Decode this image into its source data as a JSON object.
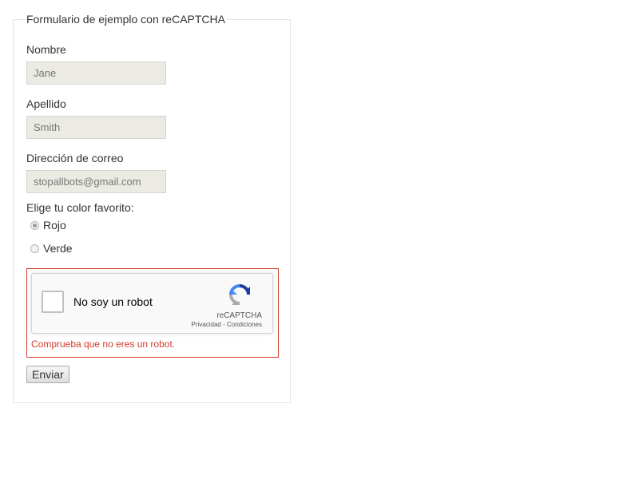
{
  "form": {
    "legend": "Formulario de ejemplo con reCAPTCHA",
    "fields": [
      {
        "label": "Nombre",
        "value": "Jane"
      },
      {
        "label": "Apellido",
        "value": "Smith"
      },
      {
        "label": "Dirección de correo",
        "value": "stopallbots@gmail.com"
      }
    ],
    "color_question": "Elige tu color favorito:",
    "color_options": [
      {
        "label": "Rojo",
        "checked": true
      },
      {
        "label": "Verde",
        "checked": false
      }
    ],
    "recaptcha": {
      "checkbox_label": "No soy un robot",
      "brand": "reCAPTCHA",
      "privacy_link": "Privacidad",
      "separator": " - ",
      "terms_link": "Condiciones"
    },
    "error_message": "Comprueba que no eres un robot.",
    "submit_label": "Enviar"
  },
  "colors": {
    "error": "#d33a2c",
    "input_bg": "#ebebe4",
    "recaptcha_blue": "#1c3aa9",
    "recaptcha_lightblue": "#4285f4",
    "recaptcha_gray": "#ababab"
  }
}
